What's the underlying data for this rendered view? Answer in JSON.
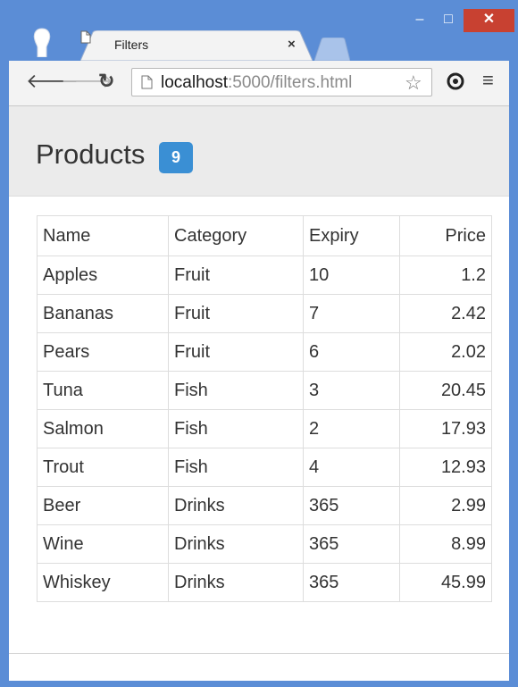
{
  "browser": {
    "tab_title": "Filters",
    "tab_close": "×",
    "url_host": "localhost",
    "url_rest": ":5000/filters.html",
    "window_controls": {
      "minimize": "–",
      "maximize": "□",
      "close": "✕"
    },
    "icons": {
      "back": "arrow-left-icon",
      "forward": "arrow-right-icon",
      "reload": "reload-icon",
      "star": "star-icon",
      "menu": "hamburger-menu-icon"
    },
    "colors": {
      "frame": "#5b8dd6",
      "close_button": "#c84131"
    }
  },
  "page": {
    "heading": "Products",
    "badge_count": "9",
    "badge_color": "#3a8fd4",
    "table": {
      "headers": [
        "Name",
        "Category",
        "Expiry",
        "Price"
      ],
      "rows": [
        [
          "Apples",
          "Fruit",
          "10",
          "1.2"
        ],
        [
          "Bananas",
          "Fruit",
          "7",
          "2.42"
        ],
        [
          "Pears",
          "Fruit",
          "6",
          "2.02"
        ],
        [
          "Tuna",
          "Fish",
          "3",
          "20.45"
        ],
        [
          "Salmon",
          "Fish",
          "2",
          "17.93"
        ],
        [
          "Trout",
          "Fish",
          "4",
          "12.93"
        ],
        [
          "Beer",
          "Drinks",
          "365",
          "2.99"
        ],
        [
          "Wine",
          "Drinks",
          "365",
          "8.99"
        ],
        [
          "Whiskey",
          "Drinks",
          "365",
          "45.99"
        ]
      ]
    }
  }
}
